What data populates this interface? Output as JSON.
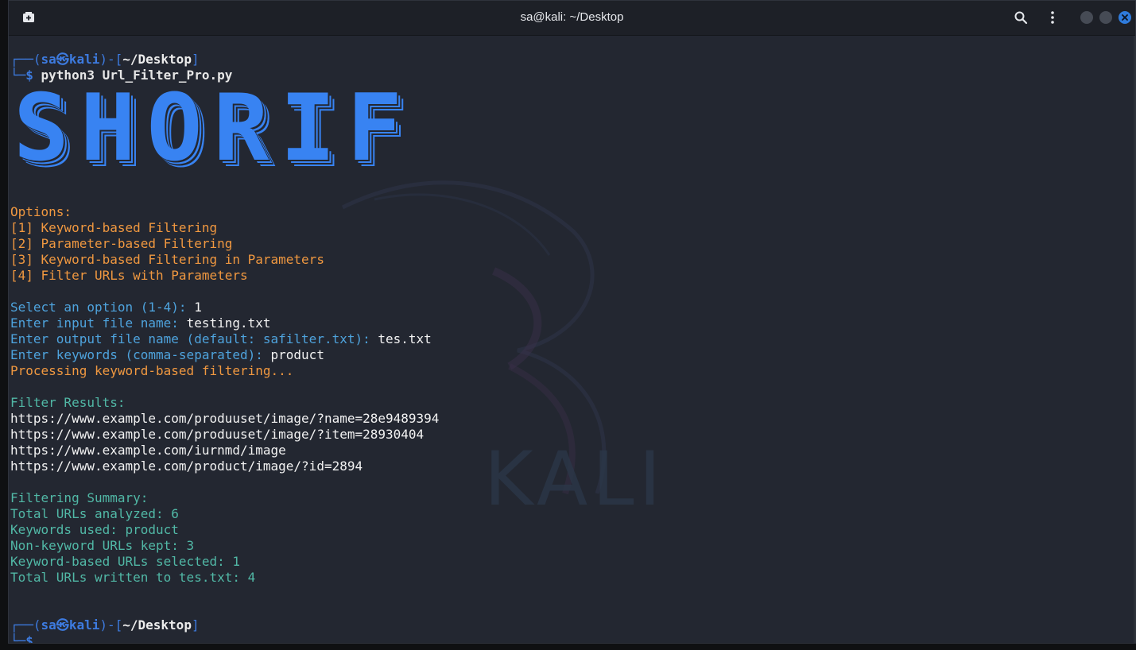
{
  "window": {
    "title": "sa@kali: ~/Desktop",
    "new_tab_icon": "new-tab-icon",
    "search_icon": "search-icon",
    "menu_icon": "kebab-menu-icon",
    "close_icon": "close-icon",
    "accent": "#2f7bdc"
  },
  "prompt1": {
    "top_left": "┌──(",
    "user": "sa",
    "skull": "㉿",
    "host": "kali",
    "mid": ")-[",
    "path": "~/Desktop",
    "end": "]",
    "bottom_left": "└─",
    "dollar": "$ ",
    "command_name": "python3 ",
    "command_arg": "Url_Filter_Pro.py"
  },
  "banner": "SHORIF",
  "options": {
    "header": "Options:",
    "items": [
      "[1] Keyword-based Filtering",
      "[2] Parameter-based Filtering",
      "[3] Keyword-based Filtering in Parameters",
      "[4] Filter URLs with Parameters"
    ]
  },
  "inputs": {
    "select_label": "Select an option (1-4): ",
    "select_value": "1",
    "input_label": "Enter input file name: ",
    "input_value": "testing.txt",
    "output_label": "Enter output file name (default: safilter.txt): ",
    "output_value": "tes.txt",
    "keywords_label": "Enter keywords (comma-separated): ",
    "keywords_value": "product",
    "processing": "Processing keyword-based filtering..."
  },
  "results": {
    "header": "Filter Results:",
    "urls": [
      "https://www.example.com/produuset/image/?name=28e9489394",
      "https://www.example.com/produuset/image/?item=28930404",
      "https://www.example.com/iurnmd/image",
      "https://www.example.com/product/image/?id=2894"
    ]
  },
  "summary": {
    "header": "Filtering Summary:",
    "lines": [
      "Total URLs analyzed: 6",
      "Keywords used: product",
      "Non-keyword URLs kept: 3",
      "Keyword-based URLs selected: 1",
      "Total URLs written to tes.txt: 4"
    ]
  },
  "prompt2": {
    "top_left": "┌──(",
    "user": "sa",
    "skull": "㉿",
    "host": "kali",
    "mid": ")-[",
    "path": "~/Desktop",
    "end": "]",
    "bottom_left": "└─",
    "dollar": "$"
  },
  "watermark": "KALI"
}
